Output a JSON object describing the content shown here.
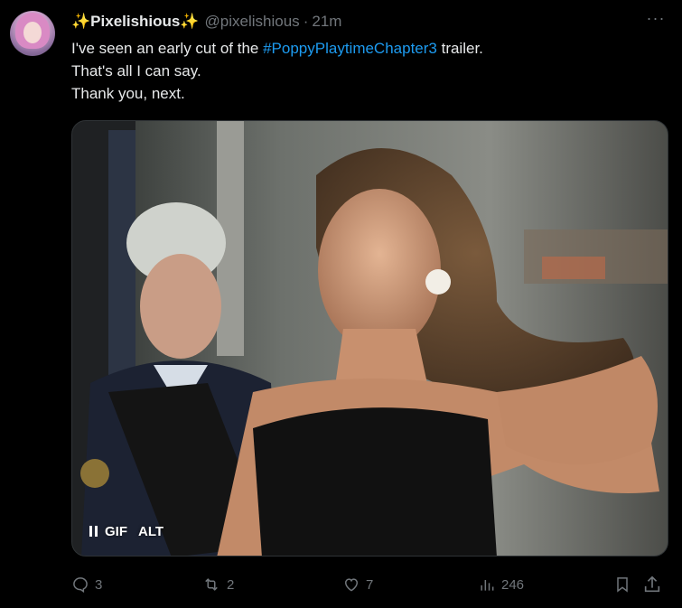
{
  "tweet": {
    "display_name": "Pixelishious",
    "sparkle_left": "✨",
    "sparkle_right": "✨",
    "handle": "@pixelishious",
    "separator": "·",
    "time": "21m",
    "more_label": "···",
    "text_line1_before": "I've seen an early cut of the ",
    "hashtag": "#PoppyPlaytimeChapter3",
    "text_line1_after": " trailer.",
    "text_line2": "That's all I can say.",
    "text_line3": "Thank you, next."
  },
  "media": {
    "gif_label": "GIF",
    "alt_label": "ALT"
  },
  "actions": {
    "replies": "3",
    "retweets": "2",
    "likes": "7",
    "views": "246"
  },
  "colors": {
    "background": "#000000",
    "text": "#e7e9ea",
    "muted": "#71767b",
    "accent": "#1d9bf0"
  }
}
